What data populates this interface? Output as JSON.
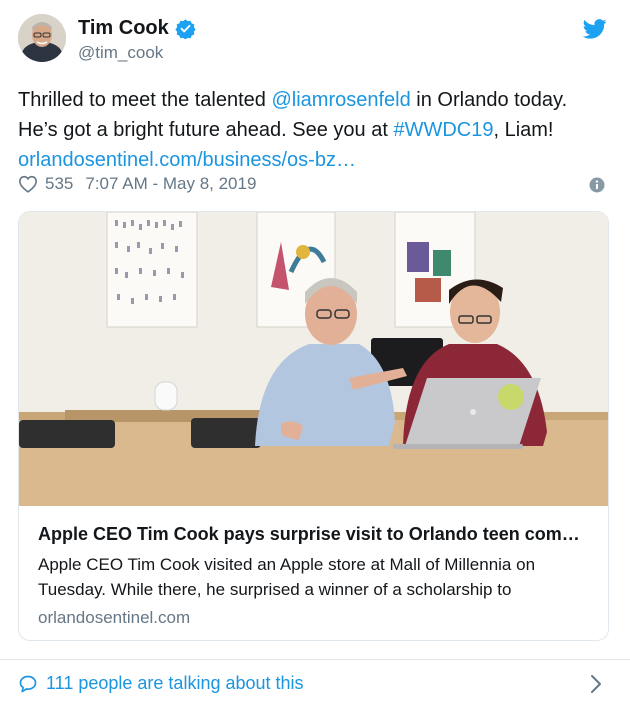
{
  "author": {
    "name": "Tim Cook",
    "handle": "@tim_cook"
  },
  "tweet": {
    "text_line1_a": "Thrilled to meet the talented ",
    "mention": "@liamrosenfeld",
    "text_line1_b": " in Orlando today.",
    "text_line2_a": "He’s got a bright future ahead. See you at ",
    "hashtag": "#WWDC19",
    "text_line2_b": ", Liam!",
    "link": "orlandosentinel.com/business/os-bz…"
  },
  "meta": {
    "likes": "535",
    "timestamp": "7:07 AM - May 8, 2019"
  },
  "card": {
    "title": "Apple CEO Tim Cook pays surprise visit to Orlando teen com…",
    "description": "Apple CEO Tim Cook visited an Apple store at Mall of Millennia on Tuesday. While there, he surprised a winner of a scholarship to",
    "domain": "orlandosentinel.com"
  },
  "footer": {
    "talking": "111 people are talking about this"
  },
  "colors": {
    "link": "#1b95e0",
    "secondary_text": "#657786",
    "border": "#e1e8ed"
  },
  "icons": [
    "verified-badge-icon",
    "twitter-bird-icon",
    "heart-icon",
    "info-icon",
    "speech-bubble-icon",
    "chevron-right-icon"
  ]
}
